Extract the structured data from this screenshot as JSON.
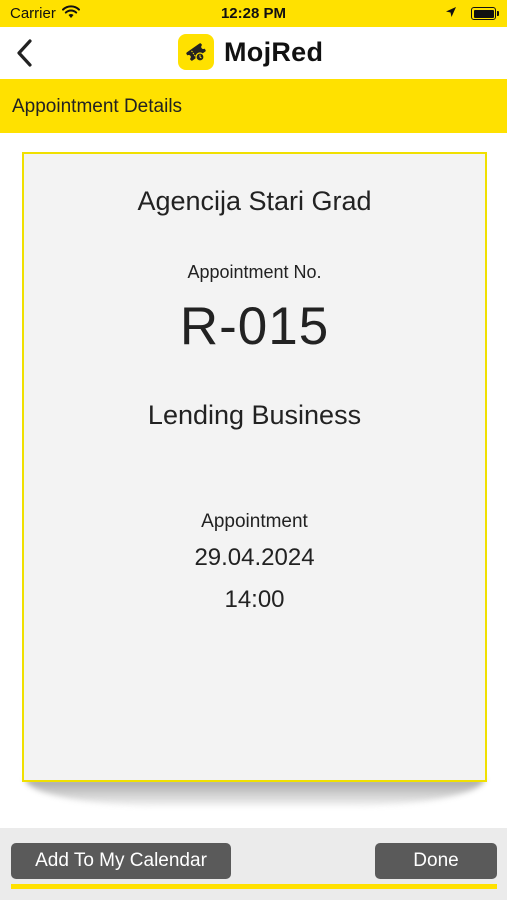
{
  "status_bar": {
    "carrier": "Carrier",
    "time": "12:28 PM"
  },
  "nav": {
    "app_title": "MojRed",
    "back_icon": "chevron-left-icon",
    "logo_icon": "ticket-logo-icon"
  },
  "section": {
    "title": "Appointment Details"
  },
  "card": {
    "office_name": "Agencija Stari Grad",
    "appointment_no_label": "Appointment No.",
    "appointment_number": "R-015",
    "service_name": "Lending Business",
    "appointment_label": "Appointment",
    "date": "29.04.2024",
    "time": "14:00"
  },
  "actions": {
    "add_calendar_label": "Add To My Calendar",
    "done_label": "Done"
  },
  "colors": {
    "accent": "#ffe100",
    "button": "#5a5a5a",
    "card_bg": "#f3f3f3",
    "card_border": "#f0e000"
  }
}
